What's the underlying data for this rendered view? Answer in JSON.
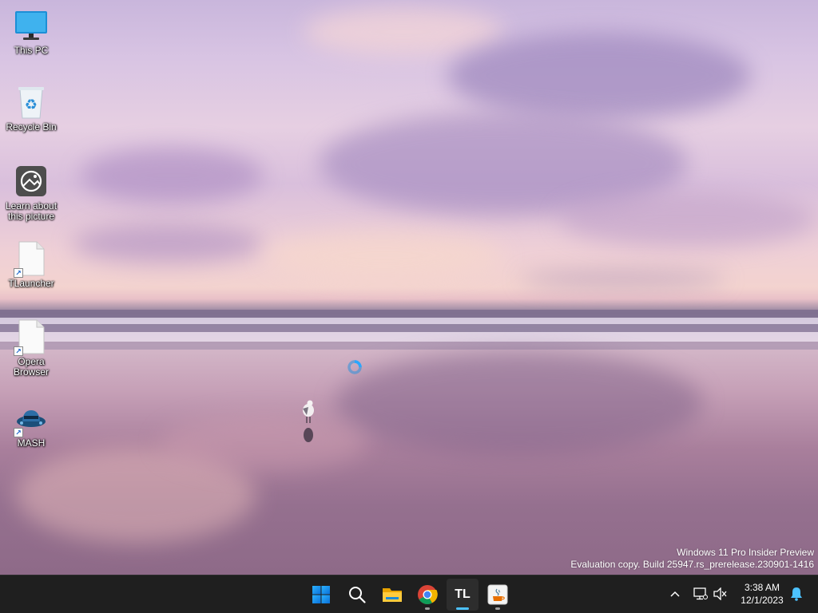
{
  "desktop": {
    "icons": [
      {
        "label": "This PC",
        "icon": "monitor-icon"
      },
      {
        "label": "Recycle Bin",
        "icon": "recycle-bin-icon"
      },
      {
        "label": "Learn about\nthis picture",
        "icon": "learn-picture-icon"
      },
      {
        "label": "TLauncher",
        "icon": "file-shortcut-icon"
      },
      {
        "label": "Opera\nBrowser",
        "icon": "file-shortcut-icon"
      },
      {
        "label": "MASH",
        "icon": "mash-app-icon"
      }
    ],
    "watermark": {
      "line1": "Windows 11 Pro Insider Preview",
      "line2": "Evaluation copy. Build 25947.rs_prerelease.230901-1416"
    }
  },
  "taskbar": {
    "apps": [
      {
        "name": "Start",
        "icon": "windows-start-icon"
      },
      {
        "name": "Search",
        "icon": "search-icon"
      },
      {
        "name": "File Explorer",
        "icon": "folder-icon"
      },
      {
        "name": "Google Chrome",
        "icon": "chrome-icon"
      },
      {
        "name": "TLauncher",
        "icon": "tlauncher-icon",
        "label": "TL",
        "active": true
      },
      {
        "name": "Java",
        "icon": "java-icon"
      }
    ],
    "tray": {
      "time": "3:38 AM",
      "date": "12/1/2023"
    },
    "colors": {
      "background": "#1f1f1f",
      "accent": "#4cc2ff"
    }
  }
}
